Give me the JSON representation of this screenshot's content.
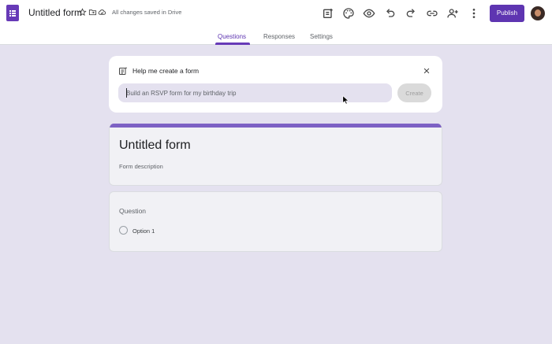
{
  "header": {
    "app_icon": "google-forms-icon",
    "title": "Untitled form",
    "save_status": "All changes saved in Drive",
    "publish_label": "Publish",
    "title_icons": [
      "star-icon",
      "move-to-folder-icon",
      "cloud-saved-icon"
    ],
    "toolbar_icons": [
      "addon-icon",
      "palette-icon",
      "preview-eye-icon",
      "undo-icon",
      "redo-icon",
      "link-icon",
      "add-collaborator-icon",
      "more-vert-icon"
    ]
  },
  "tabs": [
    {
      "label": "Questions",
      "active": true
    },
    {
      "label": "Responses",
      "active": false
    },
    {
      "label": "Settings",
      "active": false
    }
  ],
  "help_card": {
    "title": "Help me create a form",
    "placeholder": "Build an RSVP form for my birthday trip",
    "create_label": "Create"
  },
  "form": {
    "title": "Untitled form",
    "description": "Form description"
  },
  "question": {
    "title": "Question",
    "options": [
      "Option 1"
    ]
  },
  "colors": {
    "accent": "#673ab7",
    "background": "#e4e1ef",
    "publish": "#5e35b1"
  }
}
